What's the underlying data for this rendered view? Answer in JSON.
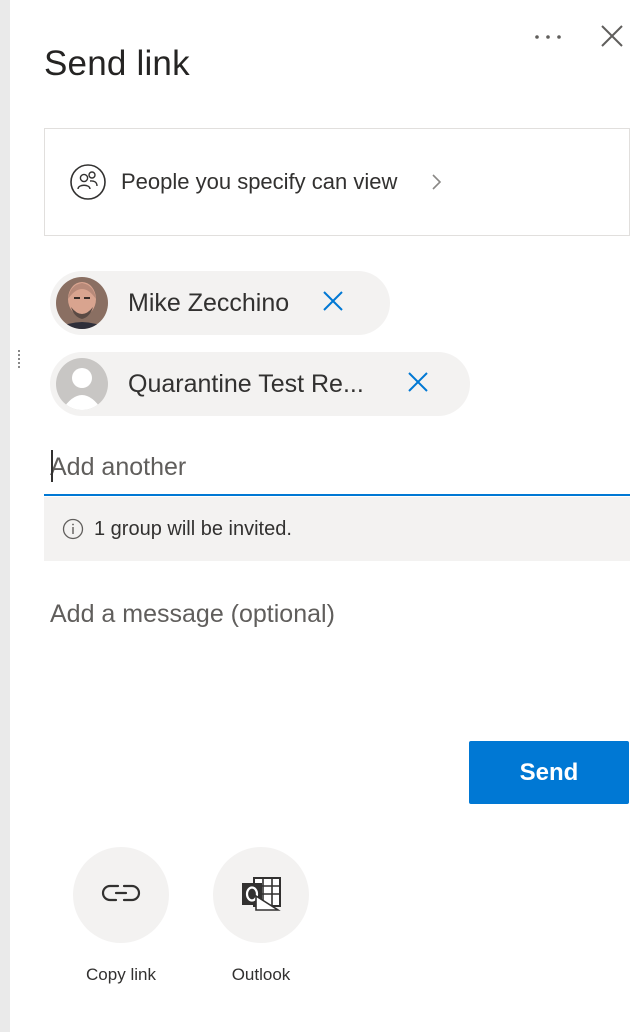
{
  "panel": {
    "title": "Send link",
    "more_icon": "ellipsis-icon",
    "close_icon": "close-icon"
  },
  "permission": {
    "icon": "people-icon",
    "label": "People you specify can view",
    "chevron": "chevron-right-icon"
  },
  "recipients": [
    {
      "name": "Mike Zecchino",
      "avatar": "photo",
      "remove_icon": "close-icon"
    },
    {
      "name": "Quarantine Test Re...",
      "avatar": "placeholder-person",
      "remove_icon": "close-icon"
    }
  ],
  "add_input": {
    "placeholder": "Add another",
    "value": ""
  },
  "info": {
    "icon": "info-icon",
    "text": "1 group will be invited."
  },
  "message": {
    "placeholder": "Add a message (optional)",
    "value": ""
  },
  "send_button": {
    "label": "Send"
  },
  "share_options": [
    {
      "label": "Copy link",
      "icon": "link-icon"
    },
    {
      "label": "Outlook",
      "icon": "outlook-icon"
    }
  ],
  "colors": {
    "accent": "#0078d4",
    "chip_bg": "#f3f2f1",
    "info_bg": "#f3f2f1"
  }
}
